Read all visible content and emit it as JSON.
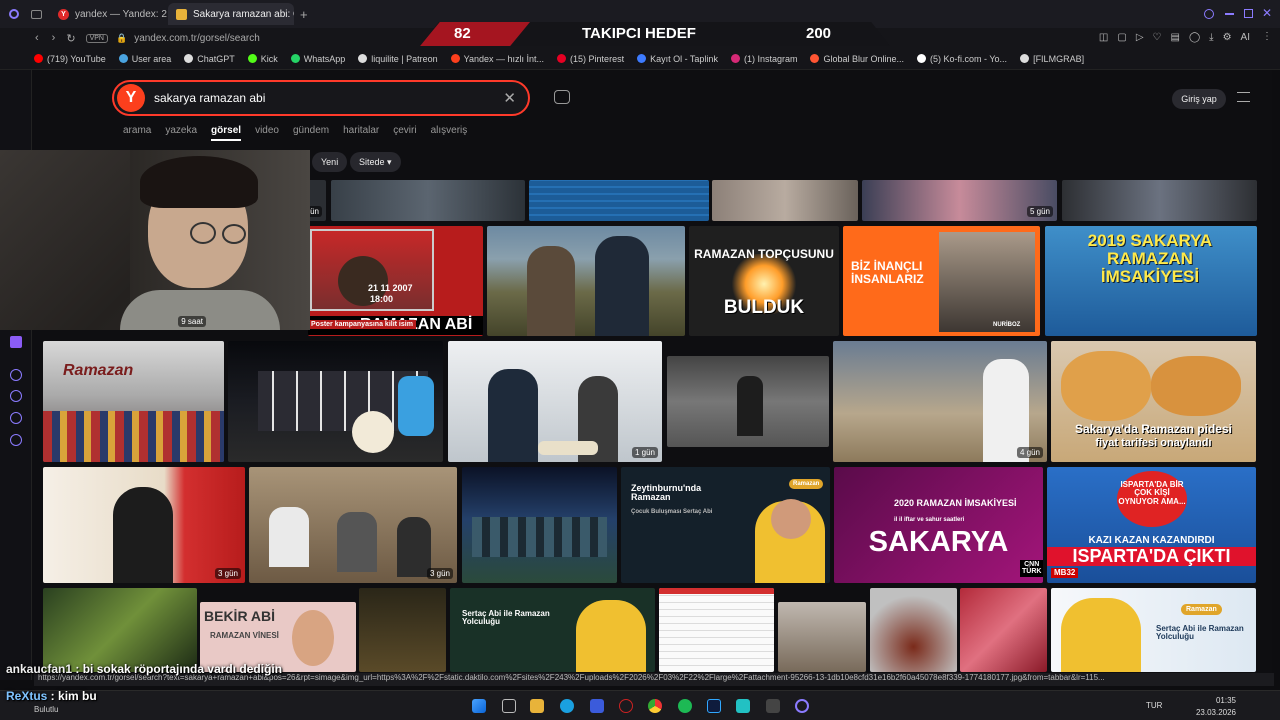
{
  "browser": {
    "tabs": [
      {
        "label": "yandex — Yandex: 2 milyon"
      },
      {
        "label": "Sakarya ramazan abi: Görs"
      }
    ],
    "new_tab": "+",
    "vpn": "VPN",
    "url": "yandex.com.tr/gorsel/search",
    "ai_label": "AI",
    "bookmarks": [
      {
        "label": "(719) YouTube",
        "color": "#ff0000"
      },
      {
        "label": "User area",
        "color": "#4aa3df"
      },
      {
        "label": "ChatGPT",
        "color": "#dddddd"
      },
      {
        "label": "Kick",
        "color": "#53fc18"
      },
      {
        "label": "WhatsApp",
        "color": "#25d366"
      },
      {
        "label": "liquilite | Patreon",
        "color": "#dddddd"
      },
      {
        "label": "Yandex — hızlı İnt...",
        "color": "#fc3f1d"
      },
      {
        "label": "(15) Pinterest",
        "color": "#e60023"
      },
      {
        "label": "Kayıt Ol - Taplink",
        "color": "#3d7bff"
      },
      {
        "label": "(1) Instagram",
        "color": "#d62976"
      },
      {
        "label": "Global Blur Online...",
        "color": "#ff5533"
      },
      {
        "label": "(5) Ko-fi.com - Yo...",
        "color": "#ffffff"
      },
      {
        "label": "[FILMGRAB]",
        "color": "#dddddd"
      }
    ]
  },
  "stream_overlay": {
    "left": "82",
    "title": "TAKIPCI HEDEF",
    "right": "200"
  },
  "yandex": {
    "logo": "Y",
    "query": "sakarya ramazan abi",
    "login": "Giriş yap",
    "search_tabs": [
      "arama",
      "yazeka",
      "görsel",
      "video",
      "gündem",
      "haritalar",
      "çeviri",
      "alışveriş"
    ],
    "active_tab": "görsel",
    "filters": [
      "Yeni",
      "Sitede"
    ],
    "chevron": "▾"
  },
  "results": {
    "top_badges": {
      "a": "gün",
      "b": "5 gün"
    },
    "row1": {
      "card1_date": "21 11 2007",
      "card1_time": "18:00",
      "card1_banner": "RAMAZAN ABİ",
      "card1_strip": "Poster kampanyasına kilit isim",
      "card3_top": "RAMAZAN TOPÇUSUNU",
      "card3_bottom": "BULDUK",
      "card4_text": "BİZ İNANÇLI İNSANLARIZ",
      "card4_brand": "NURİBOZ",
      "card5_text": "2019 SAKARYA RAMAZAN İMSAKİYESİ",
      "webcam_badge": "9 saat"
    },
    "row2": {
      "card1_text": "Ramazan",
      "card4_badge": "1 gün",
      "card6_badge": "4 gün",
      "card7_title": "Sakarya'da Ramazan pidesi",
      "card7_sub": "fiyat tarifesi onaylandı"
    },
    "row3": {
      "card1_badge": "3 gün",
      "card2_badge": "3 gün",
      "card4_title": "Zeytinburnu'nda Ramazan",
      "card4_sub": "Çocuk Buluşması Sertaç Abi",
      "card4_logo": "Ramazan",
      "card5_head": "2020 RAMAZAN İMSAKİYESİ",
      "card5_sub": "il il iftar ve sahur saatleri",
      "card5_big": "SAKARYA",
      "card5_logo": "CNN TÜRK",
      "card6_bubble": "ISPARTA'DA BİR ÇOK KİŞİ OYNUYOR AMA...",
      "card6_mid": "KAZI KAZAN KAZANDIRDI",
      "card6_big": "ISPARTA'DA ÇIKTI",
      "card6_code": "MB32"
    },
    "row4": {
      "card2_title": "BEKİR ABİ",
      "card2_sub": "RAMAZAN VİNESİ",
      "card3_title": "Sertaç Abi ile Ramazan Yolculuğu",
      "card7_title": "Sertaç Abi ile Ramazan Yolculuğu",
      "card7_logo": "Ramazan"
    }
  },
  "status_url": "https://yandex.com.tr/gorsel/search?text=sakarya+ramazan+abi&pos=26&rpt=simage&img_url=https%3A%2F%2Fstatic.daktilo.com%2Fsites%2F243%2Fuploads%2F2026%2F03%2F22%2Flarge%2Fattachment-95266-13-1db10e8cfd31e16b2f60a45078e8f339-1774180177.jpg&from=tabbar&lr=115...",
  "chat": [
    {
      "user": "ankaucfan1",
      "message": "bi sokak röportajında vardı dediğin"
    },
    {
      "user": "ReXtus",
      "message": "kim bu"
    }
  ],
  "taskbar": {
    "hidden_label": "Bulutlu",
    "lang": "TUR",
    "time": "01:35",
    "date": "23.03.2026"
  }
}
